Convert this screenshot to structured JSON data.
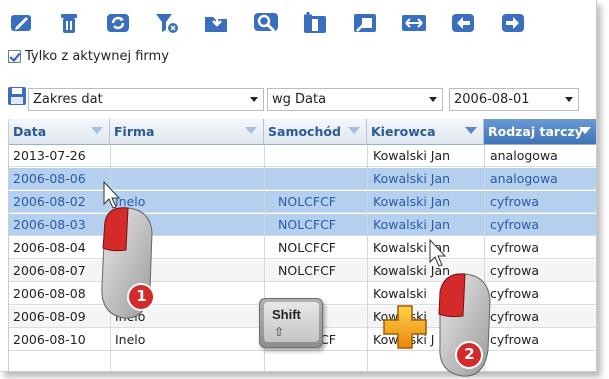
{
  "toolbar": {
    "buttons": [
      {
        "name": "edit-icon"
      },
      {
        "name": "trash-icon"
      },
      {
        "name": "refresh-icon"
      },
      {
        "name": "filter-clear-icon"
      },
      {
        "name": "folder-export-icon"
      },
      {
        "name": "search-icon"
      },
      {
        "name": "column-add-icon"
      },
      {
        "name": "window-restore-icon"
      },
      {
        "name": "fit-width-icon"
      },
      {
        "name": "arrow-left-icon"
      },
      {
        "name": "arrow-right-icon"
      }
    ]
  },
  "checkbox": {
    "label": "Tylko z aktywnej firmy",
    "checked": true
  },
  "filters": {
    "range": "Zakres dat",
    "sort": "wg Data",
    "date": "2006-08-01"
  },
  "grid": {
    "columns": [
      "Data",
      "Firma",
      "Samochód",
      "Kierowca",
      "Rodzaj tarczy"
    ],
    "active_column": "Rodzaj tarczy",
    "rows": [
      {
        "data": "2013-07-26",
        "firma": "",
        "samochod": "",
        "kierowca": "Kowalski Jan",
        "rodzaj": "analogowa",
        "selected": false
      },
      {
        "data": "2006-08-06",
        "firma": "",
        "samochod": "",
        "kierowca": "Kowalski Jan",
        "rodzaj": "analogowa",
        "selected": true
      },
      {
        "data": "2006-08-02",
        "firma": "Inelo",
        "samochod": "NOLCFCF",
        "kierowca": "Kowalski Jan",
        "rodzaj": "cyfrowa",
        "selected": true
      },
      {
        "data": "2006-08-03",
        "firma": "",
        "samochod": "NOLCFCF",
        "kierowca": "Kowalski Jan",
        "rodzaj": "cyfrowa",
        "selected": true
      },
      {
        "data": "2006-08-04",
        "firma": "",
        "samochod": "NOLCFCF",
        "kierowca": "Kowalski Jan",
        "rodzaj": "cyfrowa",
        "selected": false
      },
      {
        "data": "2006-08-07",
        "firma": "",
        "samochod": "NOLCFCF",
        "kierowca": "Kowalski Jan",
        "rodzaj": "cyfrowa",
        "selected": false
      },
      {
        "data": "2006-08-08",
        "firma": "",
        "samochod": "",
        "kierowca": "Kowalski",
        "rodzaj": "cyfrowa",
        "selected": false
      },
      {
        "data": "2006-08-09",
        "firma": "Inelo",
        "samochod": "",
        "kierowca": "Kowalski",
        "rodzaj": "cyfrowa",
        "selected": false
      },
      {
        "data": "2006-08-10",
        "firma": "Inelo",
        "samochod": "NOLCFCF",
        "kierowca": "Kowalski J",
        "rodzaj": "cyfrowa",
        "selected": false
      }
    ]
  },
  "overlay": {
    "step1": "1",
    "step2": "2",
    "key_label": "Shift",
    "key_symbol": "⇧",
    "plus": "+"
  },
  "colors": {
    "icon_blue": "#3a6fbf",
    "selection": "#b5d0ee",
    "header_active": "#3f73b8",
    "mouse_red": "#d42a2a",
    "plus_orange": "#f2a21b"
  }
}
